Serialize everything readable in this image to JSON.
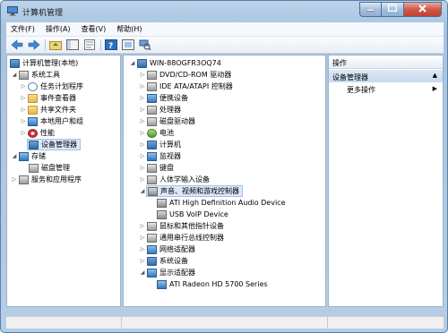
{
  "window": {
    "title": "计算机管理"
  },
  "menu": [
    "文件(F)",
    "操作(A)",
    "查看(V)",
    "帮助(H)"
  ],
  "toolbar": [
    "back-icon",
    "forward-icon",
    "up-folder-icon",
    "show-tree-icon",
    "properties-icon",
    "help-icon",
    "view-icon",
    "scan-hardware-icon"
  ],
  "left_tree": [
    {
      "label": "计算机管理(本地)",
      "icon": "computer-management-icon",
      "level": 0,
      "expander": ""
    },
    {
      "label": "系统工具",
      "icon": "system-tools-icon",
      "level": 1,
      "expander": "◢"
    },
    {
      "label": "任务计划程序",
      "icon": "task-scheduler-icon",
      "level": 2,
      "expander": "▷"
    },
    {
      "label": "事件查看器",
      "icon": "event-viewer-icon",
      "level": 2,
      "expander": "▷"
    },
    {
      "label": "共享文件夹",
      "icon": "shared-folders-icon",
      "level": 2,
      "expander": "▷"
    },
    {
      "label": "本地用户和组",
      "icon": "local-users-icon",
      "level": 2,
      "expander": "▷"
    },
    {
      "label": "性能",
      "icon": "performance-icon",
      "level": 2,
      "expander": "▷"
    },
    {
      "label": "设备管理器",
      "icon": "device-manager-icon",
      "level": 2,
      "expander": "",
      "selected": true
    },
    {
      "label": "存储",
      "icon": "storage-icon",
      "level": 1,
      "expander": "◢"
    },
    {
      "label": "磁盘管理",
      "icon": "disk-management-icon",
      "level": 2,
      "expander": ""
    },
    {
      "label": "服务和应用程序",
      "icon": "services-apps-icon",
      "level": 1,
      "expander": "▷"
    }
  ],
  "device_tree": [
    {
      "label": "WIN-88OGFR3OQ74",
      "icon": "computer-icon",
      "level": 0,
      "expander": "◢"
    },
    {
      "label": "DVD/CD-ROM 驱动器",
      "icon": "dvd-icon",
      "level": 1,
      "expander": "▷"
    },
    {
      "label": "IDE ATA/ATAPI 控制器",
      "icon": "ide-controller-icon",
      "level": 1,
      "expander": "▷"
    },
    {
      "label": "便携设备",
      "icon": "portable-device-icon",
      "level": 1,
      "expander": "▷"
    },
    {
      "label": "处理器",
      "icon": "processor-icon",
      "level": 1,
      "expander": "▷"
    },
    {
      "label": "磁盘驱动器",
      "icon": "disk-drive-icon",
      "level": 1,
      "expander": "▷"
    },
    {
      "label": "电池",
      "icon": "battery-icon",
      "level": 1,
      "expander": "▷"
    },
    {
      "label": "计算机",
      "icon": "computer-icon",
      "level": 1,
      "expander": "▷"
    },
    {
      "label": "监视器",
      "icon": "monitor-icon",
      "level": 1,
      "expander": "▷"
    },
    {
      "label": "键盘",
      "icon": "keyboard-icon",
      "level": 1,
      "expander": "▷"
    },
    {
      "label": "人体学输入设备",
      "icon": "hid-icon",
      "level": 1,
      "expander": "▷"
    },
    {
      "label": "声音、视频和游戏控制器",
      "icon": "sound-icon",
      "level": 1,
      "expander": "◢",
      "selected": true
    },
    {
      "label": "ATI High Definition Audio Device",
      "icon": "sound-device-icon",
      "level": 2,
      "expander": ""
    },
    {
      "label": "USB VoIP Device",
      "icon": "sound-device-icon",
      "level": 2,
      "expander": ""
    },
    {
      "label": "鼠标和其他指针设备",
      "icon": "mouse-icon",
      "level": 1,
      "expander": "▷"
    },
    {
      "label": "通用串行总线控制器",
      "icon": "usb-icon",
      "level": 1,
      "expander": "▷"
    },
    {
      "label": "网络适配器",
      "icon": "network-icon",
      "level": 1,
      "expander": "▷"
    },
    {
      "label": "系统设备",
      "icon": "system-device-icon",
      "level": 1,
      "expander": "▷"
    },
    {
      "label": "显示适配器",
      "icon": "display-adapter-icon",
      "level": 1,
      "expander": "◢"
    },
    {
      "label": "ATI Radeon HD 5700 Series",
      "icon": "display-card-icon",
      "level": 2,
      "expander": ""
    }
  ],
  "actions": {
    "header": "操作",
    "section": "设备管理器",
    "section_arrow": "▲",
    "more": "更多操作",
    "more_arrow": "▶"
  }
}
